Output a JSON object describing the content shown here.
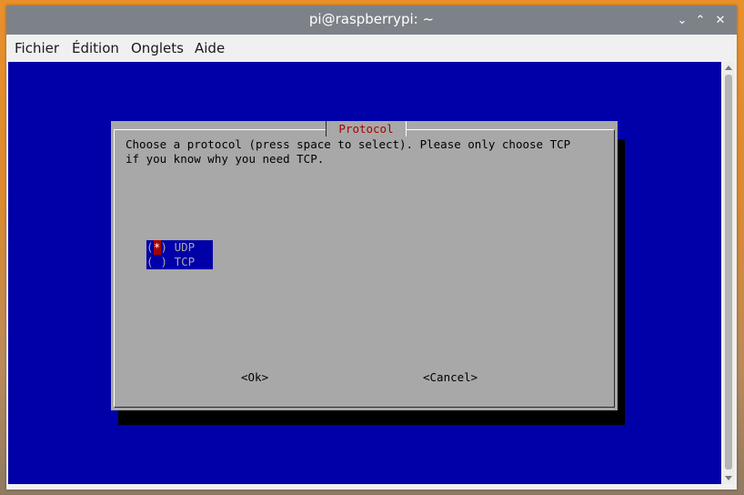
{
  "window": {
    "title": "pi@raspberrypi: ~",
    "controls": {
      "minimize": "⌄",
      "maximize": "⌃",
      "close": "✕"
    }
  },
  "menubar": {
    "items": [
      "Fichier",
      "Édition",
      "Onglets",
      "Aide"
    ]
  },
  "dialog": {
    "title": "Protocol",
    "prompt": "Choose a protocol (press space to select). Please only choose TCP\nif you know why you need TCP.",
    "options": [
      {
        "mark": "*",
        "label": "UDP",
        "selected": true
      },
      {
        "mark": " ",
        "label": "TCP",
        "selected": false
      }
    ],
    "ok_label": "<Ok>",
    "cancel_label": "<Cancel>"
  },
  "colors": {
    "terminal_bg": "#0000a8",
    "dialog_bg": "#a8a8a8",
    "title_fg": "#a80000",
    "titlebar_bg": "#7d8289"
  }
}
